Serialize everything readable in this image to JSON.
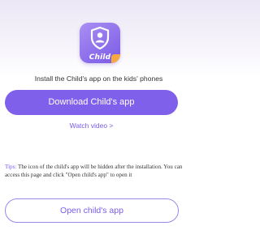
{
  "app_icon": {
    "label": "Child",
    "icon": "shield-person-icon"
  },
  "install_text": "Install the Child's app on the kids' phones",
  "download_button_label": "Download Child's app",
  "watch_video_link": "Watch video >",
  "tips": {
    "label": "Tips:",
    "text": "The icon of the child's app will be hidden after the installation. You can access this page and click \"Open child's app\" to open it"
  },
  "open_button_label": "Open child's app",
  "colors": {
    "accent": "#7f60ea",
    "link": "#7b5ce8",
    "badge": "#f7a83e"
  }
}
